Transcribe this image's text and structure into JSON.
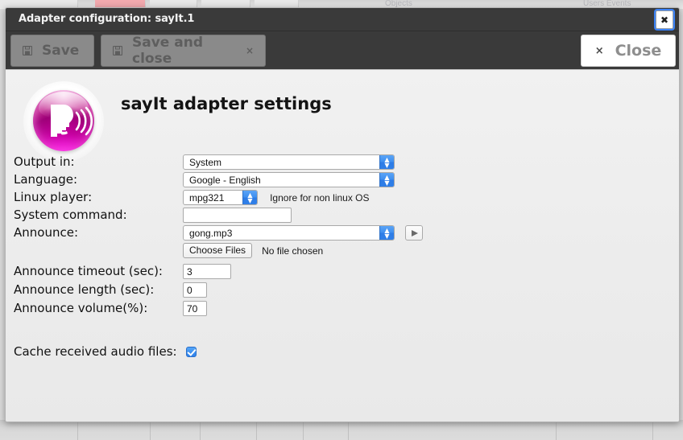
{
  "backdrop": {
    "ghost_text_left": "Objects",
    "ghost_text_right": "Users  Events"
  },
  "modal": {
    "titlebar": {
      "title": "Adapter configuration: sayIt.1",
      "close_icon": "close-icon",
      "close_label": "✖"
    },
    "toolbar": {
      "save_label": "Save",
      "save_icon": "floppy-save-icon",
      "save_and_close_label": "Save and close",
      "save_and_close_icon": "floppy-save-icon",
      "save_and_close_x": "×",
      "close_label": "Close",
      "close_x": "×"
    },
    "header": {
      "logo_name": "sayit-adapter-logo",
      "title": "sayIt adapter settings"
    },
    "form": {
      "rows": [
        {
          "label": "Output in:",
          "control": "select",
          "value": "System"
        },
        {
          "label": "Language:",
          "control": "select",
          "value": "Google - English"
        },
        {
          "label": "Linux player:",
          "control": "select",
          "value": "mpg321",
          "hint": "Ignore for non linux OS"
        },
        {
          "label": "System command:",
          "control": "text",
          "value": "",
          "placeholder": ""
        },
        {
          "label": "Announce:",
          "control": "select",
          "value": "gong.mp3",
          "play_button": "play-icon"
        }
      ],
      "file_picker": {
        "button_label": "Choose Files",
        "status": "No file chosen"
      },
      "numeric_rows": [
        {
          "label": "Announce timeout (sec):",
          "value": "3"
        },
        {
          "label": "Announce length (sec):",
          "value": "0"
        },
        {
          "label": "Announce volume(%):",
          "value": "70"
        }
      ],
      "cache_row": {
        "label": "Cache received audio files:",
        "checked": true
      }
    }
  },
  "colors": {
    "titlebar_bg": "#3a3a3a",
    "toolbar_bg": "#3a3a3a",
    "body_bg": "#ededed",
    "accent_blue": "#2e80ea",
    "focus_ring": "#3b82f6",
    "logo_magenta": "#c3009b",
    "disabled_text": "#5e5e5e"
  }
}
